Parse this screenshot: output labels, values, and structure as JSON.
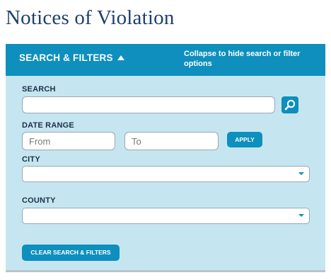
{
  "page": {
    "title": "Notices of Violation"
  },
  "panel": {
    "toggle_label": "SEARCH & FILTERS",
    "collapse_hint": "Collapse to hide search or filter options",
    "accent_color": "#0e8fbd",
    "panel_color": "#c5e6f1"
  },
  "search": {
    "label": "SEARCH",
    "value": "",
    "placeholder": ""
  },
  "date_range": {
    "label": "DATE RANGE",
    "from_placeholder": "From",
    "to_placeholder": "To",
    "apply_label": "APPLY"
  },
  "city": {
    "label": "CITY",
    "selected": ""
  },
  "county": {
    "label": "COUNTY",
    "selected": ""
  },
  "clear_label": "CLEAR SEARCH & FILTERS",
  "icons": {
    "search": "magnifier-icon",
    "toggle": "caret-up-icon",
    "dropdown": "caret-down-icon"
  }
}
